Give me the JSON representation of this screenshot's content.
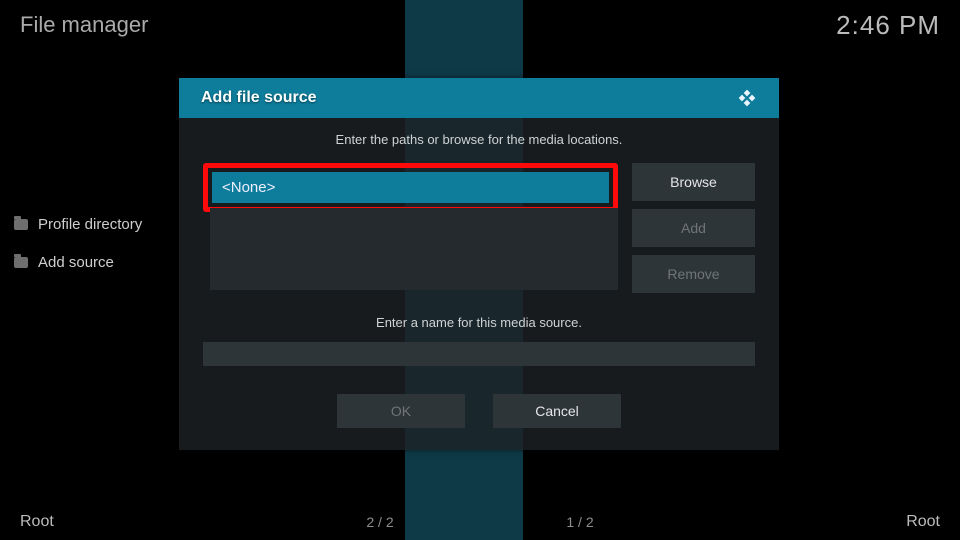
{
  "header": {
    "title": "File manager",
    "clock": "2:46 PM"
  },
  "sidebar": {
    "items": [
      {
        "label": "Profile directory"
      },
      {
        "label": "Add source"
      }
    ]
  },
  "modal": {
    "title": "Add file source",
    "prompt_paths": "Enter the paths or browse for the media locations.",
    "path_value": "<None>",
    "buttons": {
      "browse": "Browse",
      "add": "Add",
      "remove": "Remove",
      "ok": "OK",
      "cancel": "Cancel"
    },
    "prompt_name": "Enter a name for this media source.",
    "name_value": ""
  },
  "footer": {
    "left": "Root",
    "count_left": "2 / 2",
    "count_right": "1 / 2",
    "right": "Root"
  }
}
